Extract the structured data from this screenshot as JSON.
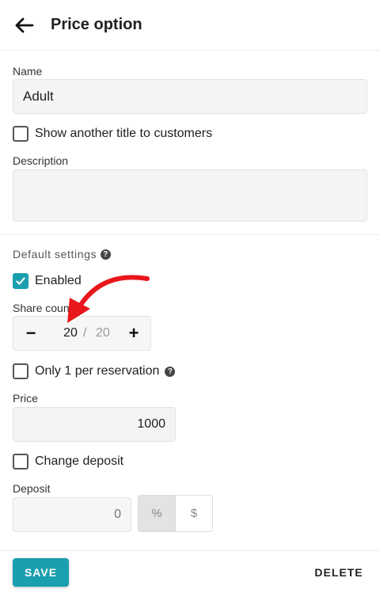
{
  "header": {
    "title": "Price option",
    "back_icon": "arrow-left-icon"
  },
  "form": {
    "name_label": "Name",
    "name_value": "Adult",
    "show_title_label": "Show another title to customers",
    "show_title_checked": false,
    "description_label": "Description",
    "description_value": "",
    "default_settings_label": "Default settings",
    "default_settings_help_icon": "help-circle-icon",
    "enabled_label": "Enabled",
    "enabled_checked": true,
    "share_count_label": "Share count",
    "share_count_value": "20",
    "share_count_separator": "/",
    "share_count_max": "20",
    "decrement_symbol": "−",
    "increment_symbol": "+",
    "only_one_label": "Only 1 per reservation",
    "only_one_checked": false,
    "price_label": "Price",
    "price_value": "1000",
    "change_deposit_label": "Change deposit",
    "change_deposit_checked": false,
    "deposit_label": "Deposit",
    "deposit_value": "0",
    "deposit_unit_percent": "%",
    "deposit_unit_dollar": "$",
    "deposit_unit_selected": "%"
  },
  "footer": {
    "save_label": "SAVE",
    "delete_label": "DELETE"
  },
  "colors": {
    "accent": "#1a9fae",
    "annotation_arrow": "#e8171b"
  }
}
